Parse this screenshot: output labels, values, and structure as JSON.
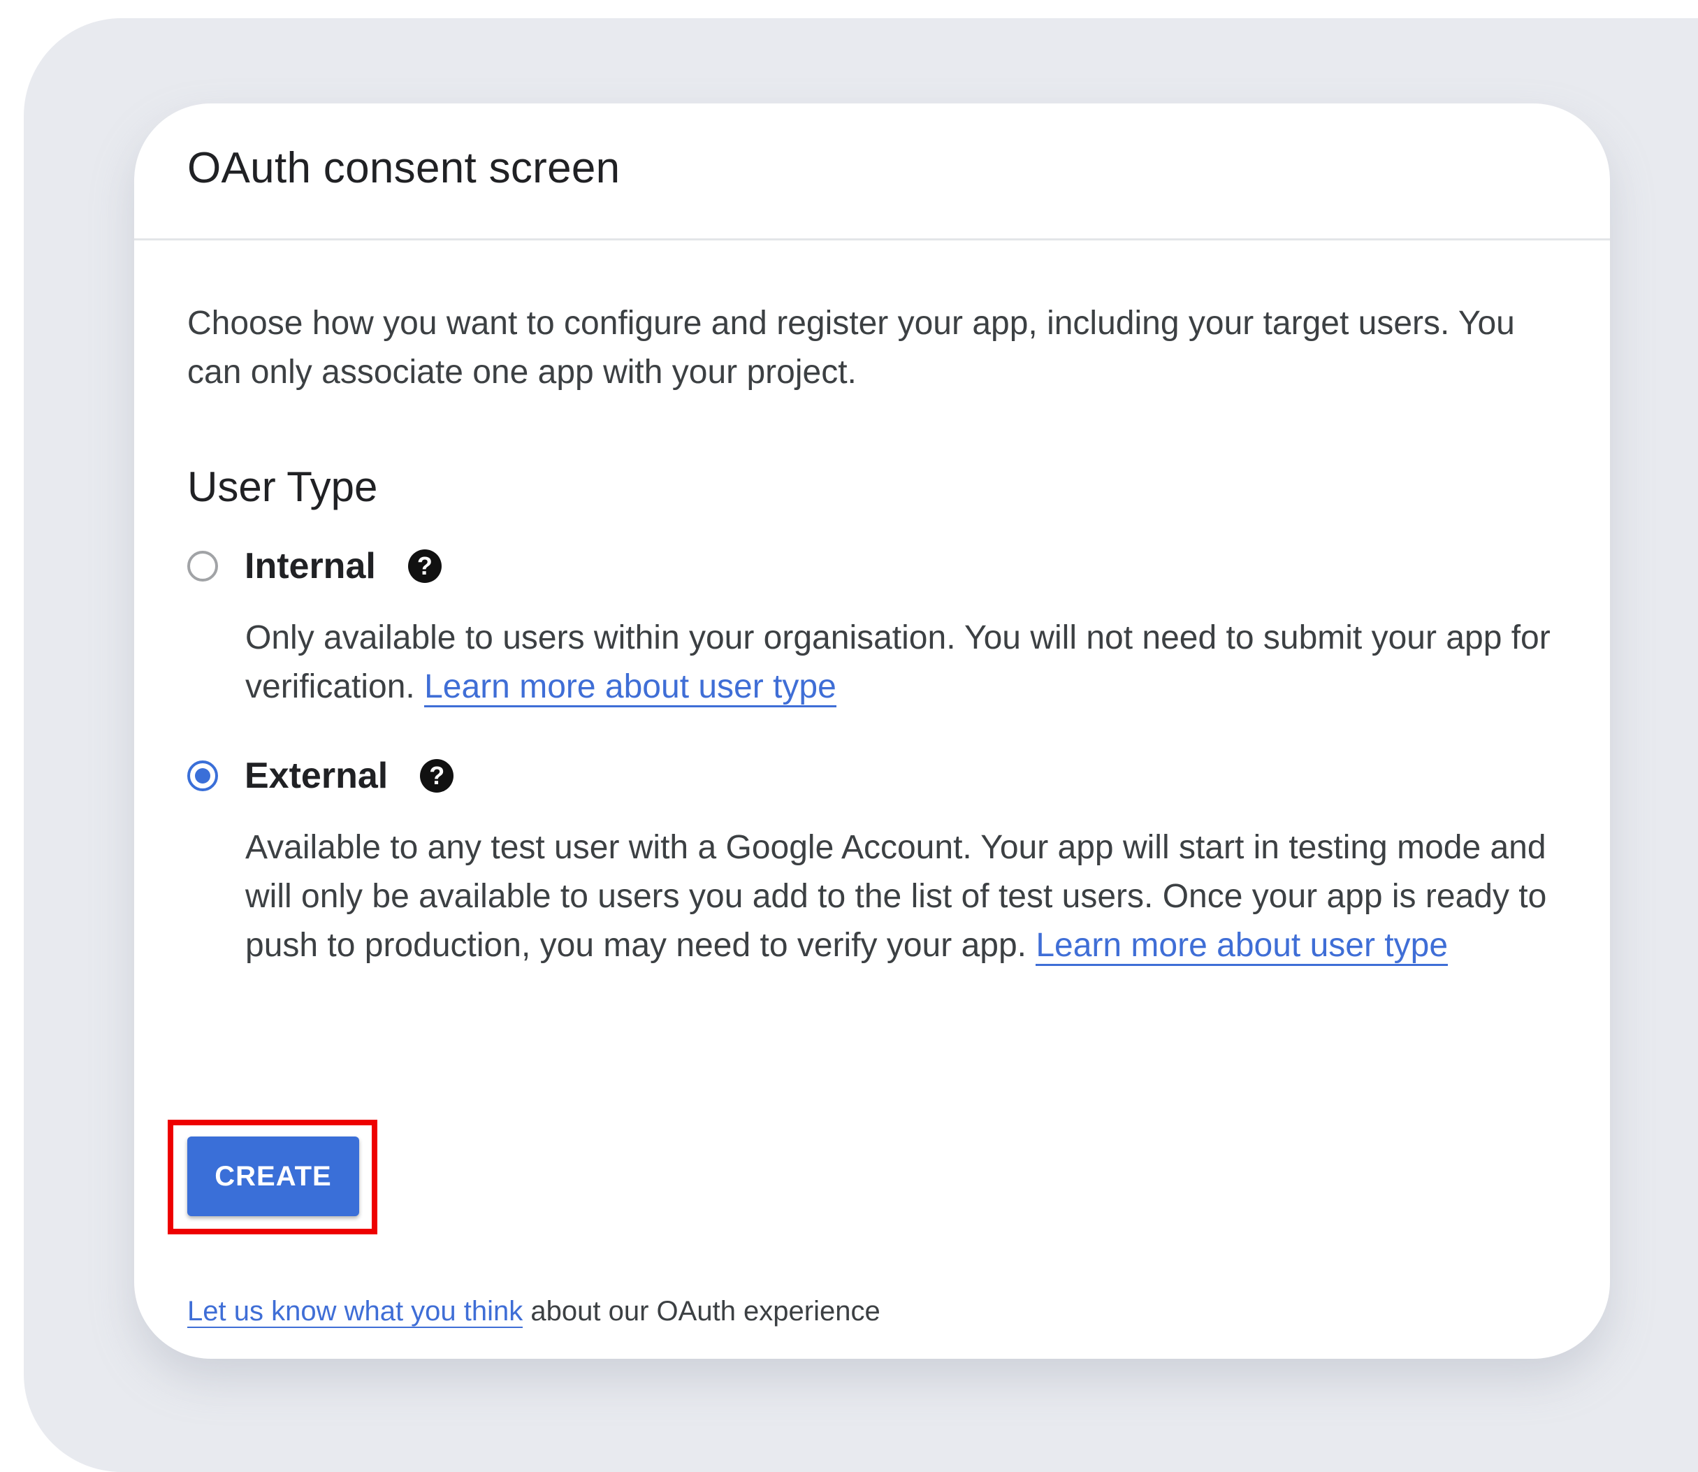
{
  "dialog": {
    "title": "OAuth consent screen",
    "intro": "Choose how you want to configure and register your app, including your target users. You can only associate one app with your project.",
    "user_type_heading": "User Type",
    "options": [
      {
        "label": "Internal",
        "checked": false,
        "help_icon": "help-question-icon",
        "description": "Only available to users within your organisation. You will not need to submit your app for verification.",
        "link": "Learn more about user type"
      },
      {
        "label": "External",
        "checked": true,
        "help_icon": "help-question-icon",
        "description": "Available to any test user with a Google Account. Your app will start in testing mode and will only be available to users you add to the list of test users. Once your app is ready to push to production, you may need to verify your app.",
        "link": "Learn more about user type"
      }
    ],
    "create_button": "CREATE",
    "feedback": {
      "link": "Let us know what you think",
      "text": "about our OAuth experience"
    }
  },
  "colors": {
    "accent": "#3a6fd8",
    "link": "#3f6ed6",
    "highlight": "#ee0000",
    "backdrop": "#e8eaef"
  }
}
